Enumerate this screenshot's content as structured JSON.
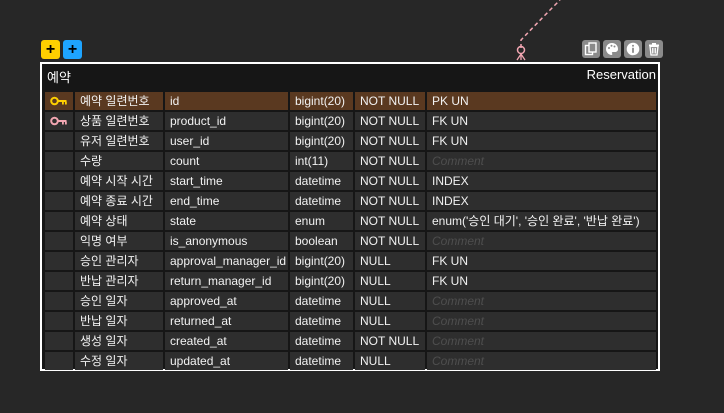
{
  "toolbar": {
    "add_left": "+",
    "add_right": "+"
  },
  "table": {
    "title": "예약",
    "name": "Reservation",
    "columns": [
      {
        "key": "pk",
        "label": "예약 일련번호",
        "name": "id",
        "type": "bigint(20)",
        "nullable": "NOT NULL",
        "extra": "PK UN",
        "placeholder": false
      },
      {
        "key": "fk",
        "label": "상품 일련번호",
        "name": "product_id",
        "type": "bigint(20)",
        "nullable": "NOT NULL",
        "extra": "FK UN",
        "placeholder": false
      },
      {
        "key": "",
        "label": "유저 일련번호",
        "name": "user_id",
        "type": "bigint(20)",
        "nullable": "NOT NULL",
        "extra": "FK UN",
        "placeholder": false
      },
      {
        "key": "",
        "label": "수량",
        "name": "count",
        "type": "int(11)",
        "nullable": "NOT NULL",
        "extra": "Comment",
        "placeholder": true
      },
      {
        "key": "",
        "label": "예약 시작 시간",
        "name": "start_time",
        "type": "datetime",
        "nullable": "NOT NULL",
        "extra": "INDEX",
        "placeholder": false
      },
      {
        "key": "",
        "label": "예약 종료 시간",
        "name": "end_time",
        "type": "datetime",
        "nullable": "NOT NULL",
        "extra": "INDEX",
        "placeholder": false
      },
      {
        "key": "",
        "label": "예약 상태",
        "name": "state",
        "type": "enum",
        "nullable": "NOT NULL",
        "extra": "enum('승인 대기', '승인 완료', '반납 완료')",
        "placeholder": false
      },
      {
        "key": "",
        "label": "익명 여부",
        "name": "is_anonymous",
        "type": "boolean",
        "nullable": "NOT NULL",
        "extra": "Comment",
        "placeholder": true
      },
      {
        "key": "",
        "label": "승인 관리자",
        "name": "approval_manager_id",
        "type": "bigint(20)",
        "nullable": "NULL",
        "extra": "FK UN",
        "placeholder": false
      },
      {
        "key": "",
        "label": "반납 관리자",
        "name": "return_manager_id",
        "type": "bigint(20)",
        "nullable": "NULL",
        "extra": "FK UN",
        "placeholder": false
      },
      {
        "key": "",
        "label": "승인 일자",
        "name": "approved_at",
        "type": "datetime",
        "nullable": "NULL",
        "extra": "Comment",
        "placeholder": true
      },
      {
        "key": "",
        "label": "반납 일자",
        "name": "returned_at",
        "type": "datetime",
        "nullable": "NULL",
        "extra": "Comment",
        "placeholder": true
      },
      {
        "key": "",
        "label": "생성 일자",
        "name": "created_at",
        "type": "datetime",
        "nullable": "NOT NULL",
        "extra": "Comment",
        "placeholder": true
      },
      {
        "key": "",
        "label": "수정 일자",
        "name": "updated_at",
        "type": "datetime",
        "nullable": "NULL",
        "extra": "Comment",
        "placeholder": true
      }
    ]
  },
  "colors": {
    "pk_key": "#ffd000",
    "fk_key": "#f2a6b2",
    "selected_row": "#5a3920",
    "relation_line": "#f2a6b2"
  },
  "icons": [
    "add-yellow-icon",
    "add-blue-icon",
    "copy-icon",
    "palette-icon",
    "info-icon",
    "trash-icon",
    "key-icon"
  ]
}
